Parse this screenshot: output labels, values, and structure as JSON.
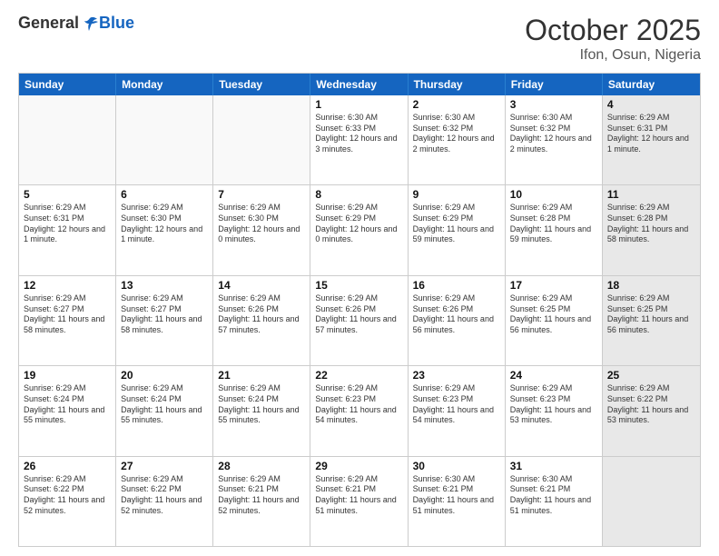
{
  "header": {
    "logo_general": "General",
    "logo_blue": "Blue",
    "month": "October 2025",
    "location": "Ifon, Osun, Nigeria"
  },
  "days_of_week": [
    "Sunday",
    "Monday",
    "Tuesday",
    "Wednesday",
    "Thursday",
    "Friday",
    "Saturday"
  ],
  "weeks": [
    [
      {
        "day": "",
        "text": "",
        "empty": true
      },
      {
        "day": "",
        "text": "",
        "empty": true
      },
      {
        "day": "",
        "text": "",
        "empty": true
      },
      {
        "day": "1",
        "text": "Sunrise: 6:30 AM\nSunset: 6:33 PM\nDaylight: 12 hours and 3 minutes.",
        "empty": false
      },
      {
        "day": "2",
        "text": "Sunrise: 6:30 AM\nSunset: 6:32 PM\nDaylight: 12 hours and 2 minutes.",
        "empty": false
      },
      {
        "day": "3",
        "text": "Sunrise: 6:30 AM\nSunset: 6:32 PM\nDaylight: 12 hours and 2 minutes.",
        "empty": false
      },
      {
        "day": "4",
        "text": "Sunrise: 6:29 AM\nSunset: 6:31 PM\nDaylight: 12 hours and 1 minute.",
        "empty": false,
        "shaded": true
      }
    ],
    [
      {
        "day": "5",
        "text": "Sunrise: 6:29 AM\nSunset: 6:31 PM\nDaylight: 12 hours and 1 minute.",
        "empty": false
      },
      {
        "day": "6",
        "text": "Sunrise: 6:29 AM\nSunset: 6:30 PM\nDaylight: 12 hours and 1 minute.",
        "empty": false
      },
      {
        "day": "7",
        "text": "Sunrise: 6:29 AM\nSunset: 6:30 PM\nDaylight: 12 hours and 0 minutes.",
        "empty": false
      },
      {
        "day": "8",
        "text": "Sunrise: 6:29 AM\nSunset: 6:29 PM\nDaylight: 12 hours and 0 minutes.",
        "empty": false
      },
      {
        "day": "9",
        "text": "Sunrise: 6:29 AM\nSunset: 6:29 PM\nDaylight: 11 hours and 59 minutes.",
        "empty": false
      },
      {
        "day": "10",
        "text": "Sunrise: 6:29 AM\nSunset: 6:28 PM\nDaylight: 11 hours and 59 minutes.",
        "empty": false
      },
      {
        "day": "11",
        "text": "Sunrise: 6:29 AM\nSunset: 6:28 PM\nDaylight: 11 hours and 58 minutes.",
        "empty": false,
        "shaded": true
      }
    ],
    [
      {
        "day": "12",
        "text": "Sunrise: 6:29 AM\nSunset: 6:27 PM\nDaylight: 11 hours and 58 minutes.",
        "empty": false
      },
      {
        "day": "13",
        "text": "Sunrise: 6:29 AM\nSunset: 6:27 PM\nDaylight: 11 hours and 58 minutes.",
        "empty": false
      },
      {
        "day": "14",
        "text": "Sunrise: 6:29 AM\nSunset: 6:26 PM\nDaylight: 11 hours and 57 minutes.",
        "empty": false
      },
      {
        "day": "15",
        "text": "Sunrise: 6:29 AM\nSunset: 6:26 PM\nDaylight: 11 hours and 57 minutes.",
        "empty": false
      },
      {
        "day": "16",
        "text": "Sunrise: 6:29 AM\nSunset: 6:26 PM\nDaylight: 11 hours and 56 minutes.",
        "empty": false
      },
      {
        "day": "17",
        "text": "Sunrise: 6:29 AM\nSunset: 6:25 PM\nDaylight: 11 hours and 56 minutes.",
        "empty": false
      },
      {
        "day": "18",
        "text": "Sunrise: 6:29 AM\nSunset: 6:25 PM\nDaylight: 11 hours and 56 minutes.",
        "empty": false,
        "shaded": true
      }
    ],
    [
      {
        "day": "19",
        "text": "Sunrise: 6:29 AM\nSunset: 6:24 PM\nDaylight: 11 hours and 55 minutes.",
        "empty": false
      },
      {
        "day": "20",
        "text": "Sunrise: 6:29 AM\nSunset: 6:24 PM\nDaylight: 11 hours and 55 minutes.",
        "empty": false
      },
      {
        "day": "21",
        "text": "Sunrise: 6:29 AM\nSunset: 6:24 PM\nDaylight: 11 hours and 55 minutes.",
        "empty": false
      },
      {
        "day": "22",
        "text": "Sunrise: 6:29 AM\nSunset: 6:23 PM\nDaylight: 11 hours and 54 minutes.",
        "empty": false
      },
      {
        "day": "23",
        "text": "Sunrise: 6:29 AM\nSunset: 6:23 PM\nDaylight: 11 hours and 54 minutes.",
        "empty": false
      },
      {
        "day": "24",
        "text": "Sunrise: 6:29 AM\nSunset: 6:23 PM\nDaylight: 11 hours and 53 minutes.",
        "empty": false
      },
      {
        "day": "25",
        "text": "Sunrise: 6:29 AM\nSunset: 6:22 PM\nDaylight: 11 hours and 53 minutes.",
        "empty": false,
        "shaded": true
      }
    ],
    [
      {
        "day": "26",
        "text": "Sunrise: 6:29 AM\nSunset: 6:22 PM\nDaylight: 11 hours and 52 minutes.",
        "empty": false
      },
      {
        "day": "27",
        "text": "Sunrise: 6:29 AM\nSunset: 6:22 PM\nDaylight: 11 hours and 52 minutes.",
        "empty": false
      },
      {
        "day": "28",
        "text": "Sunrise: 6:29 AM\nSunset: 6:21 PM\nDaylight: 11 hours and 52 minutes.",
        "empty": false
      },
      {
        "day": "29",
        "text": "Sunrise: 6:29 AM\nSunset: 6:21 PM\nDaylight: 11 hours and 51 minutes.",
        "empty": false
      },
      {
        "day": "30",
        "text": "Sunrise: 6:30 AM\nSunset: 6:21 PM\nDaylight: 11 hours and 51 minutes.",
        "empty": false
      },
      {
        "day": "31",
        "text": "Sunrise: 6:30 AM\nSunset: 6:21 PM\nDaylight: 11 hours and 51 minutes.",
        "empty": false
      },
      {
        "day": "",
        "text": "",
        "empty": true,
        "shaded": true
      }
    ]
  ]
}
